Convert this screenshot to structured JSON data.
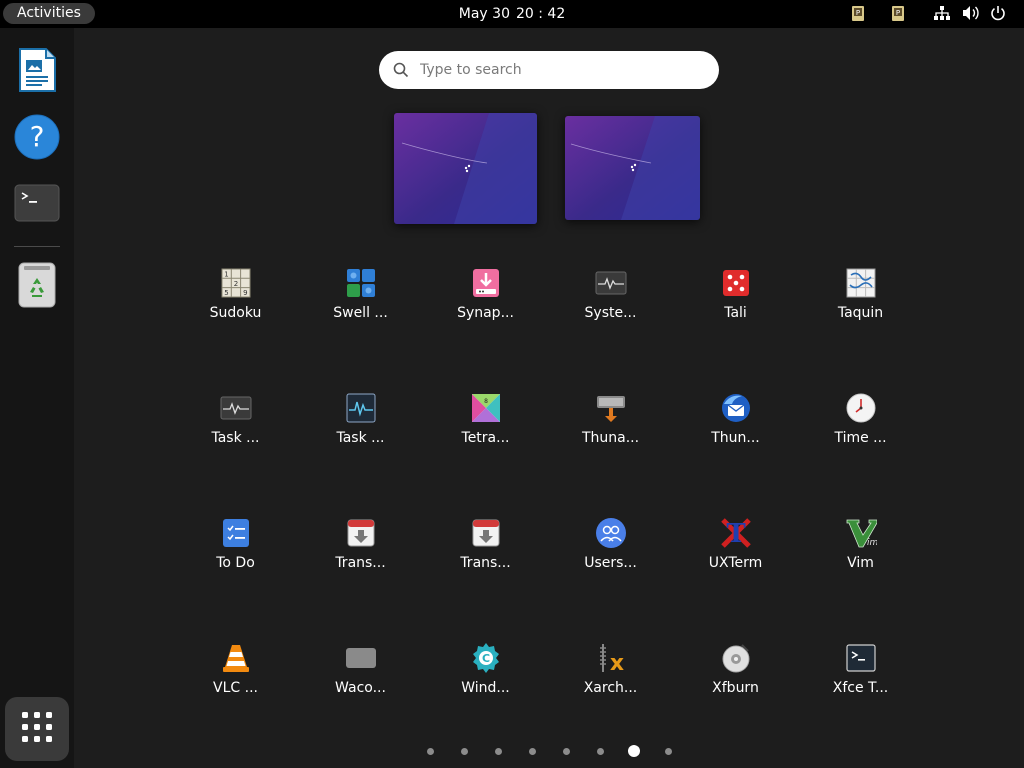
{
  "topbar": {
    "activities": "Activities",
    "date": "May 30",
    "time": "20 : 42"
  },
  "dock": {
    "items": [
      {
        "name": "LibreOffice Writer",
        "icon": "writer-icon"
      },
      {
        "name": "Help",
        "icon": "help-icon"
      },
      {
        "name": "Terminal",
        "icon": "terminal-icon"
      },
      {
        "name": "Trash",
        "icon": "trash-icon"
      }
    ],
    "show_apps_icon": "app-grid-icon"
  },
  "search": {
    "placeholder": "Type to search"
  },
  "apps": [
    {
      "label": "Sudoku",
      "icon": "sudoku-icon"
    },
    {
      "label": "Swell ...",
      "icon": "swell-foop-icon"
    },
    {
      "label": "Synap...",
      "icon": "synaptic-icon"
    },
    {
      "label": "Syste...",
      "icon": "system-monitor-icon"
    },
    {
      "label": "Tali",
      "icon": "tali-icon"
    },
    {
      "label": "Taquin",
      "icon": "taquin-icon"
    },
    {
      "label": "Task ...",
      "icon": "task-manager-icon"
    },
    {
      "label": "Task ...",
      "icon": "task-manager-2-icon"
    },
    {
      "label": "Tetra...",
      "icon": "tetravex-icon"
    },
    {
      "label": "Thuna...",
      "icon": "thunar-icon"
    },
    {
      "label": "Thun...",
      "icon": "thunderbird-icon"
    },
    {
      "label": "Time ...",
      "icon": "clock-icon"
    },
    {
      "label": "To Do",
      "icon": "todo-icon"
    },
    {
      "label": "Trans...",
      "icon": "transmission-icon"
    },
    {
      "label": "Trans...",
      "icon": "transmission-2-icon"
    },
    {
      "label": "Users...",
      "icon": "users-icon"
    },
    {
      "label": "UXTerm",
      "icon": "uxterm-icon"
    },
    {
      "label": "Vim",
      "icon": "vim-icon"
    },
    {
      "label": "VLC ...",
      "icon": "vlc-icon"
    },
    {
      "label": "Waco...",
      "icon": "wacom-icon"
    },
    {
      "label": "Wind...",
      "icon": "window-settings-icon"
    },
    {
      "label": "Xarch...",
      "icon": "xarchiver-icon"
    },
    {
      "label": "Xfburn",
      "icon": "xfburn-icon"
    },
    {
      "label": "Xfce T...",
      "icon": "xfce-terminal-icon"
    }
  ],
  "pagination": {
    "pages": 8,
    "current": 7
  },
  "colors": {
    "background": "#1d1d1d",
    "topbar": "#000000",
    "dock": "#151515",
    "active_dot": "#ffffff"
  }
}
